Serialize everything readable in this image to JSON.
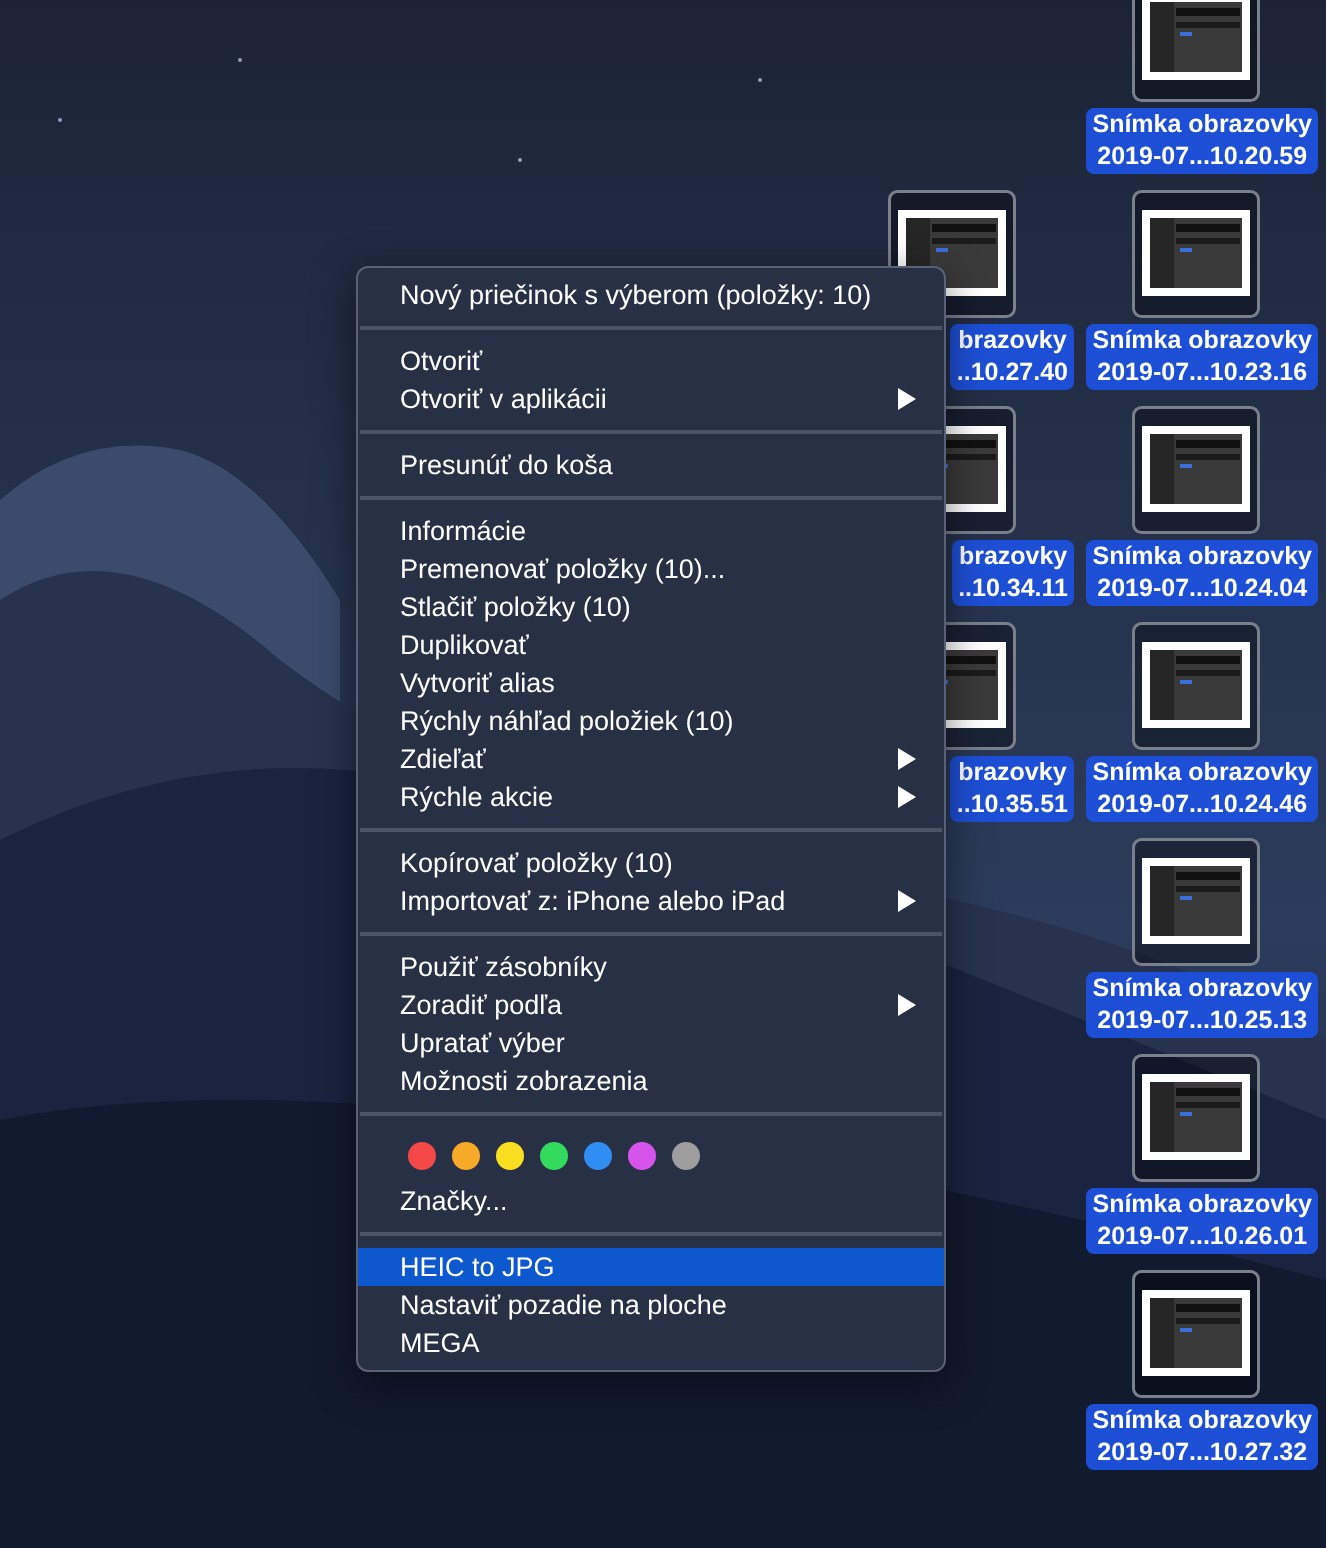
{
  "desktop": {
    "columns": [
      {
        "files": [
          {
            "label_lines": [
              "brazovky",
              "..10.27.40"
            ],
            "selected": true
          },
          {
            "label_lines": [
              "brazovky",
              "..10.34.11"
            ],
            "selected": true
          },
          {
            "label_lines": [
              "brazovky",
              "..10.35.51"
            ],
            "selected": true
          }
        ]
      },
      {
        "files": [
          {
            "label_lines": [
              "Snímka obrazovky",
              "2019-07...10.20.59"
            ],
            "selected": true
          },
          {
            "label_lines": [
              "Snímka obrazovky",
              "2019-07...10.23.16"
            ],
            "selected": true
          },
          {
            "label_lines": [
              "Snímka obrazovky",
              "2019-07...10.24.04"
            ],
            "selected": true
          },
          {
            "label_lines": [
              "Snímka obrazovky",
              "2019-07...10.24.46"
            ],
            "selected": true
          },
          {
            "label_lines": [
              "Snímka obrazovky",
              "2019-07...10.25.13"
            ],
            "selected": true
          },
          {
            "label_lines": [
              "Snímka obrazovky",
              "2019-07...10.26.01"
            ],
            "selected": true
          },
          {
            "label_lines": [
              "Snímka obrazovky",
              "2019-07...10.27.32"
            ],
            "selected": true
          }
        ]
      }
    ]
  },
  "context_menu": {
    "sections": [
      [
        {
          "kind": "item",
          "label": "Nový priečinok s výberom (položky: 10)",
          "submenu": false,
          "selected": false
        }
      ],
      [
        {
          "kind": "item",
          "label": "Otvoriť",
          "submenu": false,
          "selected": false
        },
        {
          "kind": "item",
          "label": "Otvoriť v aplikácii",
          "submenu": true,
          "selected": false
        }
      ],
      [
        {
          "kind": "item",
          "label": "Presunúť do koša",
          "submenu": false,
          "selected": false
        }
      ],
      [
        {
          "kind": "item",
          "label": "Informácie",
          "submenu": false,
          "selected": false
        },
        {
          "kind": "item",
          "label": "Premenovať položky (10)...",
          "submenu": false,
          "selected": false
        },
        {
          "kind": "item",
          "label": "Stlačiť položky (10)",
          "submenu": false,
          "selected": false
        },
        {
          "kind": "item",
          "label": "Duplikovať",
          "submenu": false,
          "selected": false
        },
        {
          "kind": "item",
          "label": "Vytvoriť alias",
          "submenu": false,
          "selected": false
        },
        {
          "kind": "item",
          "label": "Rýchly náhľad položiek (10)",
          "submenu": false,
          "selected": false
        },
        {
          "kind": "item",
          "label": "Zdieľať",
          "submenu": true,
          "selected": false
        },
        {
          "kind": "item",
          "label": "Rýchle akcie",
          "submenu": true,
          "selected": false
        }
      ],
      [
        {
          "kind": "item",
          "label": "Kopírovať položky (10)",
          "submenu": false,
          "selected": false
        },
        {
          "kind": "item",
          "label": "Importovať z: iPhone alebo iPad",
          "submenu": true,
          "selected": false
        }
      ],
      [
        {
          "kind": "item",
          "label": "Použiť zásobníky",
          "submenu": false,
          "selected": false
        },
        {
          "kind": "item",
          "label": "Zoradiť podľa",
          "submenu": true,
          "selected": false
        },
        {
          "kind": "item",
          "label": "Upratať výber",
          "submenu": false,
          "selected": false
        },
        {
          "kind": "item",
          "label": "Možnosti zobrazenia",
          "submenu": false,
          "selected": false
        }
      ],
      [
        {
          "kind": "tags",
          "tags": [
            {
              "color": "#f44848"
            },
            {
              "color": "#f7a928"
            },
            {
              "color": "#f9df1f"
            },
            {
              "color": "#32db5c"
            },
            {
              "color": "#2f8ef2"
            },
            {
              "color": "#d754ec"
            },
            {
              "color": "#9e9e9e"
            }
          ]
        },
        {
          "kind": "item",
          "label": "Značky...",
          "submenu": false,
          "selected": false
        }
      ],
      [
        {
          "kind": "item",
          "label": "HEIC to JPG",
          "submenu": false,
          "selected": true
        },
        {
          "kind": "item",
          "label": "Nastaviť pozadie na ploche",
          "submenu": false,
          "selected": false
        },
        {
          "kind": "item",
          "label": "MEGA",
          "submenu": false,
          "selected": false
        }
      ]
    ]
  }
}
